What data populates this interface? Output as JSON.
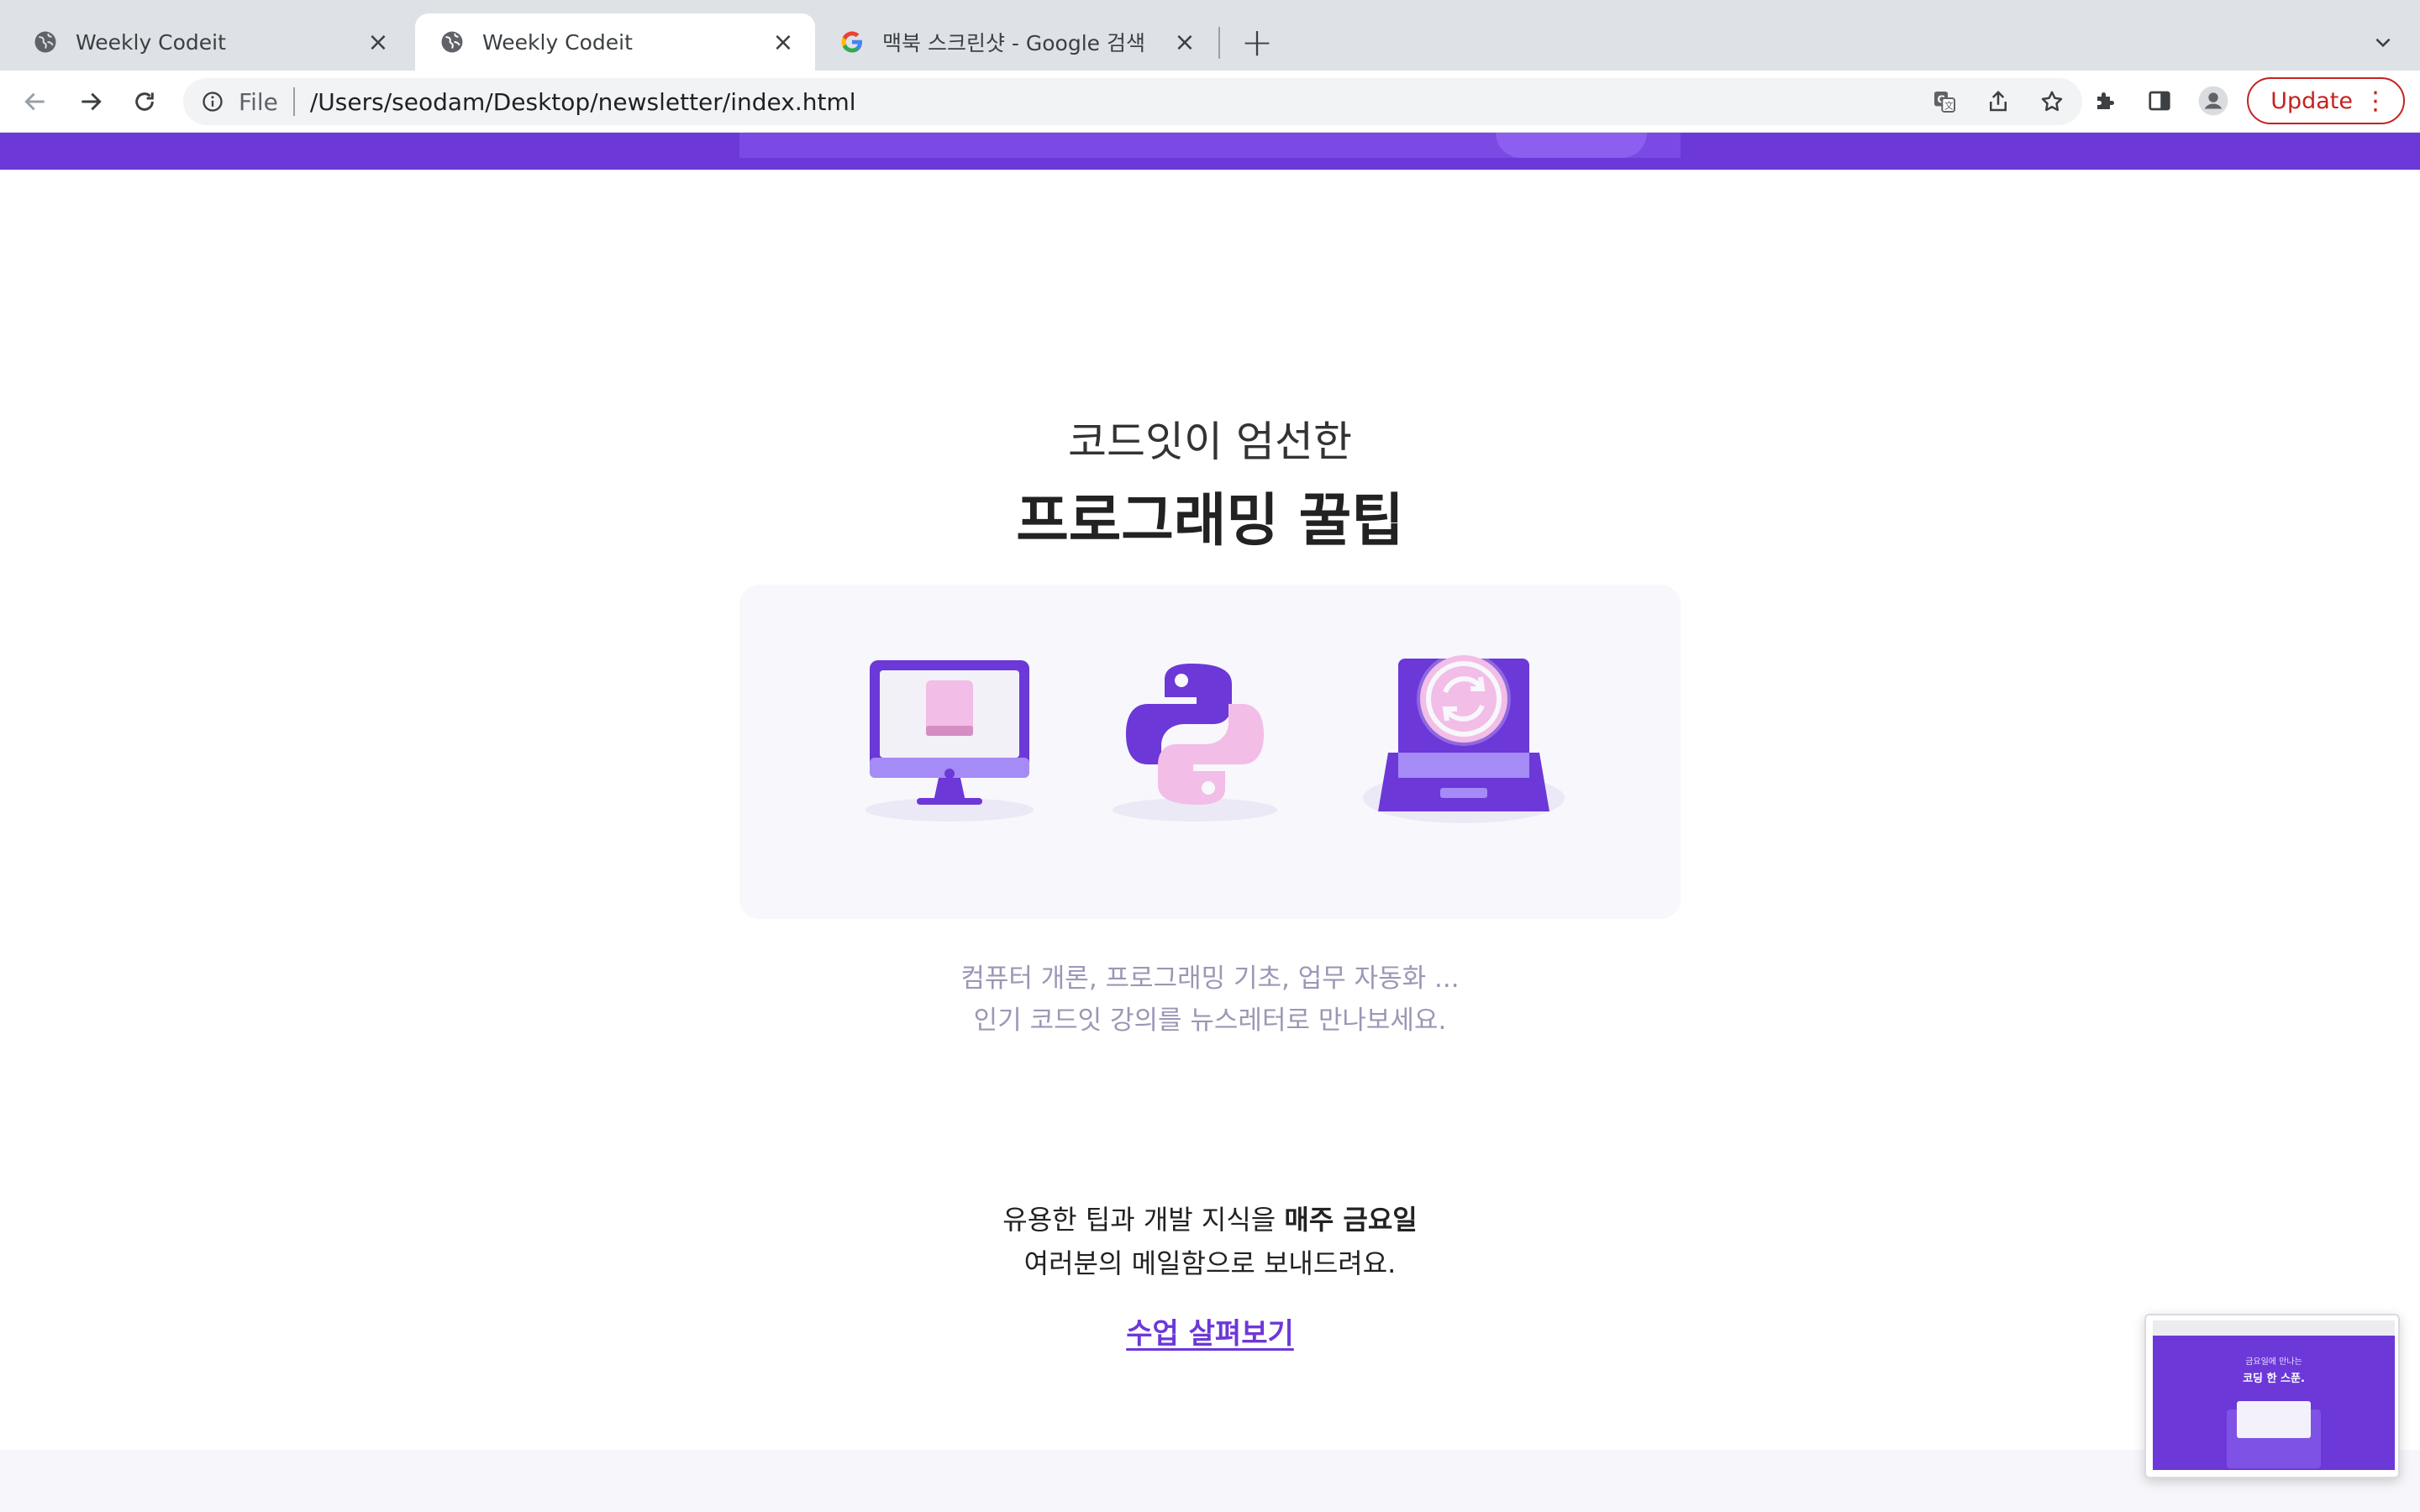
{
  "browser": {
    "tabs": [
      {
        "title": "Weekly Codeit",
        "icon": "globe-icon",
        "active": false
      },
      {
        "title": "Weekly Codeit",
        "icon": "globe-icon",
        "active": true
      },
      {
        "title": "맥북 스크린샷 - Google 검색",
        "icon": "google-g-icon",
        "active": false
      }
    ],
    "new_tab_label": "+",
    "omnibox": {
      "scheme": "File",
      "url": "/Users/seodam/Desktop/newsletter/index.html"
    },
    "update_label": "Update"
  },
  "page": {
    "subtitle": "코드잇이 엄선한",
    "title": "프로그래밍 꿀팁",
    "illustrations": [
      "desktop-monitor-icon",
      "python-logo-icon",
      "laptop-sync-icon"
    ],
    "description_lines": [
      "컴퓨터 개론, 프로그래밍 기초, 업무 자동화 ...",
      "인기 코드잇 강의를 뉴스레터로 만나보세요."
    ],
    "tip_line1_prefix": "유용한 팁과 개발 지식을 ",
    "tip_line1_bold": "매주 금요일",
    "tip_line2": "여러분의 메일함으로 보내드려요.",
    "cta_label": "수업 살펴보기"
  },
  "thumbnail": {
    "text_small": "금요일에 만나는",
    "text_large": "코딩 한 스푼."
  },
  "colors": {
    "brand_purple": "#6c38d8",
    "light_purple": "#a58bf5",
    "pink": "#f2bde6",
    "muted_text": "#9b97b5"
  }
}
